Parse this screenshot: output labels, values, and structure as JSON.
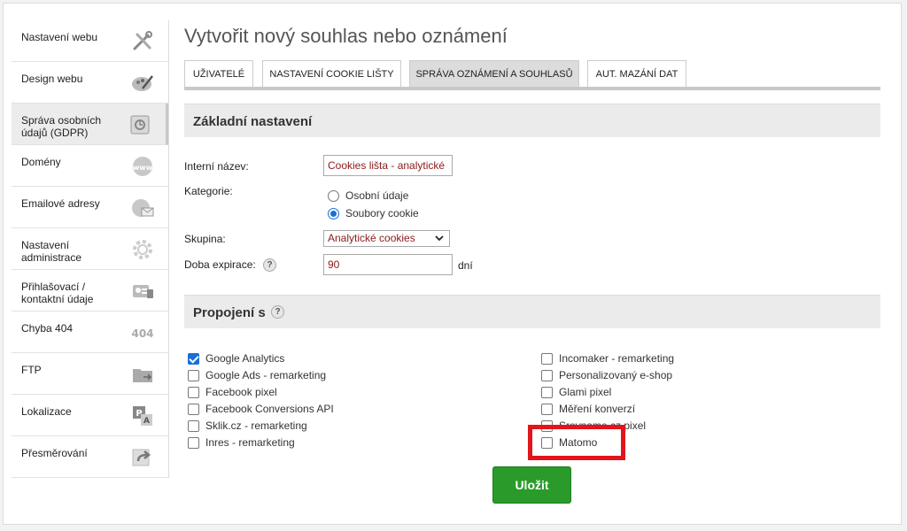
{
  "page_title": "Vytvořit nový souhlas nebo oznámení",
  "sidebar": {
    "items": [
      {
        "label": "Nastavení webu",
        "icon": "tools-icon"
      },
      {
        "label": "Design webu",
        "icon": "palette-icon"
      },
      {
        "label": "Správa osobních údajů (GDPR)",
        "icon": "safe-icon",
        "active": true
      },
      {
        "label": "Domény",
        "icon": "www-globe-icon"
      },
      {
        "label": "Emailové adresy",
        "icon": "email-globe-icon"
      },
      {
        "label": "Nastavení administrace",
        "icon": "gear-icon"
      },
      {
        "label": "Přihlašovací / kontaktní údaje",
        "icon": "contacts-icon"
      },
      {
        "label": "Chyba 404",
        "icon": "error-404-icon"
      },
      {
        "label": "FTP",
        "icon": "folder-icon"
      },
      {
        "label": "Lokalizace",
        "icon": "localization-icon"
      },
      {
        "label": "Přesměrování",
        "icon": "redirect-icon"
      }
    ]
  },
  "tabs": [
    {
      "label": "UŽIVATELÉ"
    },
    {
      "label": "NASTAVENÍ COOKIE LIŠTY"
    },
    {
      "label": "SPRÁVA OZNÁMENÍ A SOUHLASŮ",
      "active": true
    },
    {
      "label": "AUT. MAZÁNÍ DAT"
    }
  ],
  "basic": {
    "section_title": "Základní nastavení",
    "internal_name_label": "Interní název:",
    "internal_name_value": "Cookies lišta - analytické",
    "category_label": "Kategorie:",
    "category_options": [
      {
        "label": "Osobní údaje",
        "selected": false
      },
      {
        "label": "Soubory cookie",
        "selected": true
      }
    ],
    "group_label": "Skupina:",
    "group_value": "Analytické cookies",
    "expiration_label": "Doba expirace:",
    "expiration_value": "90",
    "expiration_unit": "dní",
    "help_glyph": "?"
  },
  "connections": {
    "section_title": "Propojení s",
    "help_glyph": "?",
    "left": [
      {
        "label": "Google Analytics",
        "checked": true
      },
      {
        "label": "Google Ads - remarketing",
        "checked": false
      },
      {
        "label": "Facebook pixel",
        "checked": false
      },
      {
        "label": "Facebook Conversions API",
        "checked": false
      },
      {
        "label": "Sklik.cz - remarketing",
        "checked": false
      },
      {
        "label": "Inres - remarketing",
        "checked": false
      }
    ],
    "right": [
      {
        "label": "Incomaker - remarketing",
        "checked": false
      },
      {
        "label": "Personalizovaný e-shop",
        "checked": false
      },
      {
        "label": "Glami pixel",
        "checked": false
      },
      {
        "label": "Měření konverzí",
        "checked": false
      },
      {
        "label": "Srovname.cz pixel",
        "checked": false
      },
      {
        "label": "Matomo",
        "checked": false
      }
    ]
  },
  "save_label": "Uložit",
  "colors": {
    "accent": "#1a6fd4",
    "save": "#2a9b2a",
    "highlight": "#e3141b",
    "value_text": "#8b1a1a"
  }
}
